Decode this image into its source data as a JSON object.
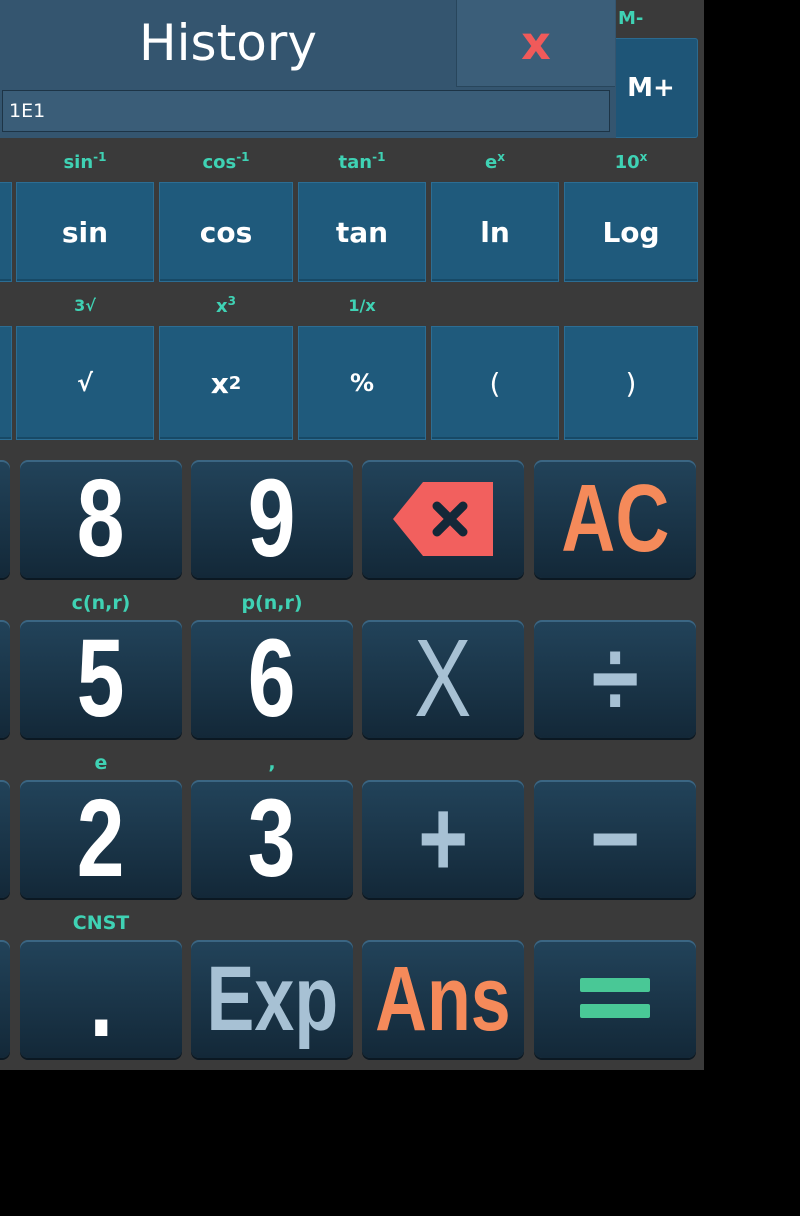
{
  "memory": {
    "minus_label": "M-",
    "plus_label": "M+"
  },
  "history": {
    "title": "History",
    "close_label": "x",
    "entries": [
      "1E1"
    ]
  },
  "scientific": {
    "row1": [
      {
        "shift": "sin",
        "shift_sup": "-1",
        "label": "sin"
      },
      {
        "shift": "cos",
        "shift_sup": "-1",
        "label": "cos"
      },
      {
        "shift": "tan",
        "shift_sup": "-1",
        "label": "tan"
      },
      {
        "shift": "e",
        "shift_sup": "x",
        "label": "ln"
      },
      {
        "shift": "10",
        "shift_sup": "x",
        "label": "Log"
      }
    ],
    "row2": [
      {
        "shift": "3√",
        "label": "√"
      },
      {
        "shift": "x",
        "shift_sup": "3",
        "label": "x",
        "label_sup": "2"
      },
      {
        "shift": "1/x",
        "label": "%"
      },
      {
        "shift": "",
        "label": "("
      },
      {
        "shift": "",
        "label": ")"
      }
    ]
  },
  "keypad": {
    "row1": [
      "8",
      "9",
      "⌫",
      "AC"
    ],
    "row2_subs": [
      "c(n,r)",
      "p(n,r)"
    ],
    "row2": [
      "5",
      "6",
      "X",
      "÷"
    ],
    "row3_subs": [
      "e",
      ","
    ],
    "row3": [
      "2",
      "3",
      "+",
      "−"
    ],
    "row4_subs": [
      "CNST"
    ],
    "row4": [
      ".",
      "Exp",
      "Ans",
      "="
    ]
  },
  "colors": {
    "accent": "#3fd2b4",
    "orange": "#f58a5a",
    "delete": "#f2605e",
    "equals": "#49c896"
  }
}
